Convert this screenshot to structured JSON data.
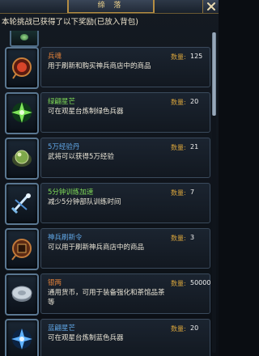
{
  "window": {
    "title": "缔 落"
  },
  "notice": "本轮挑战已获得了以下奖励(已放入背包)",
  "colors": {
    "name_orange": "#e3823a",
    "name_green": "#7fdc57",
    "name_blue": "#61a8e8",
    "qty_label": "#d8a43c"
  },
  "rewards": [
    {
      "icon": "soul-gem-icon",
      "name": "兵魂",
      "name_color": "#e3823a",
      "desc": "用于刷新和购买神兵商店中的商品",
      "qty_label": "数量:",
      "qty": "125"
    },
    {
      "icon": "green-star-shard-icon",
      "name": "绿翩星芒",
      "name_color": "#7fdc57",
      "desc": "可在观星台炼制绿色兵器",
      "qty_label": "数量:",
      "qty": "20"
    },
    {
      "icon": "exp-pill-icon",
      "name": "5万经验丹",
      "name_color": "#61a8e8",
      "desc": "武将可以获得5万经验",
      "qty_label": "数量:",
      "qty": "21"
    },
    {
      "icon": "speedup-sword-icon",
      "name": "5分钟训练加速",
      "name_color": "#7fdc57",
      "desc": "减少5分钟部队训练时间",
      "qty_label": "数量:",
      "qty": "7"
    },
    {
      "icon": "refresh-token-icon",
      "name": "神兵刷新令",
      "name_color": "#61a8e8",
      "desc": "可以用于刷新神兵商店中的商品",
      "qty_label": "数量:",
      "qty": "3"
    },
    {
      "icon": "silver-coin-icon",
      "name": "银两",
      "name_color": "#e3823a",
      "desc": "通用货币，可用于装备强化和茶馆品茶等",
      "qty_label": "数量:",
      "qty": "50000"
    },
    {
      "icon": "blue-star-shard-icon",
      "name": "蓝翩星芒",
      "name_color": "#61a8e8",
      "desc": "可在观星台炼制蓝色兵器",
      "qty_label": "数量:",
      "qty": "20"
    }
  ],
  "scroll": {
    "position_fraction": 0.0,
    "visible_fraction": 0.26
  }
}
